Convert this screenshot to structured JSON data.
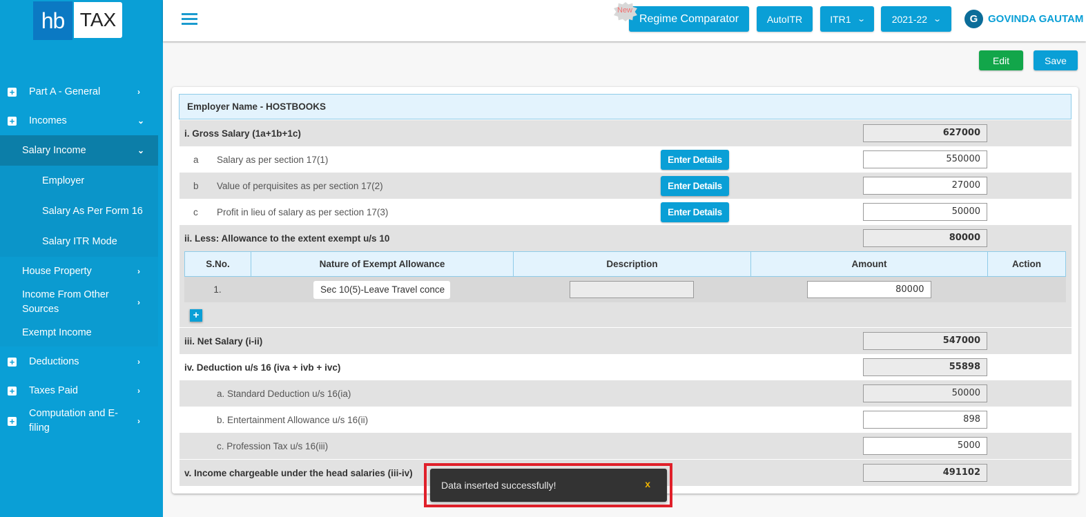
{
  "brand": {
    "logo_left": "hb",
    "logo_right": "TAX"
  },
  "colors": {
    "primary": "#0a9fd6",
    "sidebar_active": "#0c7ea8",
    "edit_green": "#12a64a",
    "toast_bg": "#333333",
    "toast_close": "#f0b400",
    "highlight_red": "#e0202a"
  },
  "sidebar": {
    "items": [
      {
        "label": "Part A - General",
        "icon": "plus-box-icon",
        "chevron": "›"
      },
      {
        "label": "Incomes",
        "icon": "plus-box-icon",
        "chevron": "⌄"
      },
      {
        "label": "Salary Income",
        "chevron": "⌄"
      },
      {
        "label": "Employer"
      },
      {
        "label": "Salary As Per Form 16"
      },
      {
        "label": "Salary ITR Mode"
      },
      {
        "label": "House Property",
        "chevron": "›"
      },
      {
        "label": "Income From Other Sources",
        "chevron": "›"
      },
      {
        "label": "Exempt Income"
      },
      {
        "label": "Deductions",
        "icon": "plus-box-icon",
        "chevron": "›"
      },
      {
        "label": "Taxes Paid",
        "icon": "plus-box-icon",
        "chevron": "›"
      },
      {
        "label": "Computation and E-filing",
        "icon": "plus-box-icon",
        "chevron": "›"
      }
    ]
  },
  "topbar": {
    "menu_icon": "hamburger-icon",
    "new_badge": "New",
    "regime_comparator": "Regime Comparator",
    "autoitr": "AutoITR",
    "itr_form": "ITR1",
    "assessment_year": "2021-22",
    "user_initial": "G",
    "user_name": "GOVINDA GAUTAM"
  },
  "actions": {
    "edit": "Edit",
    "save": "Save"
  },
  "form": {
    "employer_header": "Employer Name - HOSTBOOKS",
    "enter_details": "Enter Details",
    "gross_salary": {
      "label": "i. Gross Salary (1a+1b+1c)",
      "value": "627000"
    },
    "salary_items": [
      {
        "letter": "a",
        "label": "Salary as per section 17(1)",
        "value": "550000"
      },
      {
        "letter": "b",
        "label": "Value of perquisites as per section 17(2)",
        "value": "27000"
      },
      {
        "letter": "c",
        "label": "Profit in lieu of salary as per section 17(3)",
        "value": "50000"
      }
    ],
    "allowance": {
      "label": "ii. Less: Allowance to the extent exempt u/s 10",
      "value": "80000"
    },
    "allowance_table": {
      "headers": [
        "S.No.",
        "Nature of Exempt Allowance",
        "Description",
        "Amount",
        "Action"
      ],
      "rows": [
        {
          "sno": "1.",
          "nature": "Sec 10(5)-Leave Travel conce",
          "description": "",
          "amount": "80000"
        }
      ],
      "add_label": "+"
    },
    "net_salary": {
      "label": "iii. Net Salary (i-ii)",
      "value": "547000"
    },
    "deduction16": {
      "label": "iv. Deduction u/s 16 (iva + ivb + ivc)",
      "value": "55898"
    },
    "deduction_items": [
      {
        "label": "a. Standard Deduction u/s 16(ia)",
        "value": "50000"
      },
      {
        "label": "b. Entertainment Allowance u/s 16(ii)",
        "value": "898"
      },
      {
        "label": "c. Profession Tax u/s 16(iii)",
        "value": "5000"
      }
    ],
    "income_chargeable": {
      "label": "v. Income chargeable under the head salaries (iii-iv)",
      "value": "491102"
    }
  },
  "toast": {
    "message": "Data inserted successfully!",
    "close": "x"
  }
}
